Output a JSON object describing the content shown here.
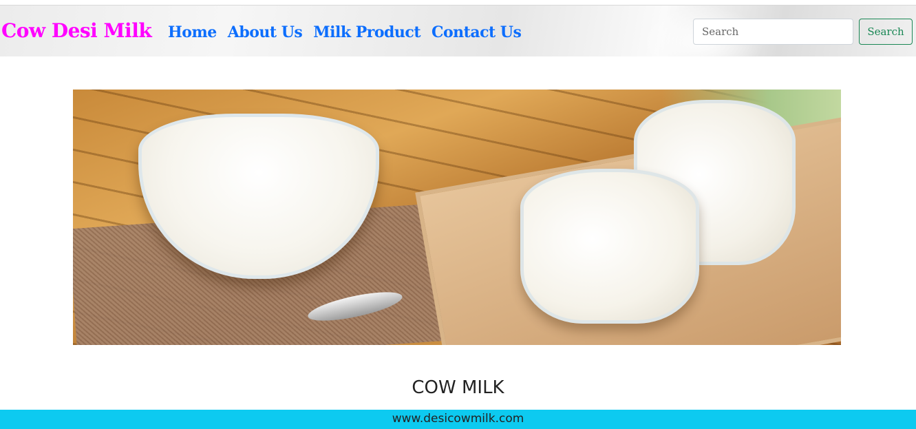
{
  "navbar": {
    "brand": "Cow Desi Milk",
    "links": [
      {
        "label": "Home"
      },
      {
        "label": "About Us"
      },
      {
        "label": "Milk Product"
      },
      {
        "label": "Contact Us"
      }
    ],
    "search": {
      "placeholder": "Search",
      "value": "",
      "button_label": "Search"
    }
  },
  "hero": {
    "image_description_icon": "milk-bowl-and-jars-image"
  },
  "main": {
    "heading": "COW MILK"
  },
  "footer": {
    "text": "www.desicowmilk.com"
  },
  "colors": {
    "brand": "#ff00ff",
    "link": "#0d6efd",
    "search_button": "#198754",
    "footer_bg": "#0dcaf0"
  }
}
